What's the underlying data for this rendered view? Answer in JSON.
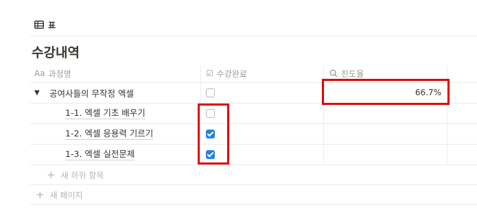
{
  "view": {
    "icon": "table-icon",
    "label": "표"
  },
  "page_title": "수강내역",
  "columns": {
    "name": {
      "icon": "text-property-icon",
      "icon_glyph": "Aa",
      "label": "과정명"
    },
    "completed": {
      "icon": "checkbox-property-icon",
      "icon_glyph": "☑",
      "label": "수강완료"
    },
    "progress": {
      "icon": "search-formula-icon",
      "icon_glyph": "🔍",
      "label": "진도율"
    }
  },
  "parent_row": {
    "name": "공여사들의 무작정 엑셀",
    "completed": false,
    "progress": "66.7%"
  },
  "sub_rows": [
    {
      "name": "1-1. 엑셀 기초 배우기",
      "completed": false
    },
    {
      "name": "1-2. 엑셀 응용력 기르기",
      "completed": true
    },
    {
      "name": "1-3. 엑셀 실전문제",
      "completed": true
    }
  ],
  "add_subitem_label": "새 하위 항목",
  "add_page_label": "새 페이지",
  "colors": {
    "accent": "#2383e2",
    "highlight": "#e00000"
  }
}
